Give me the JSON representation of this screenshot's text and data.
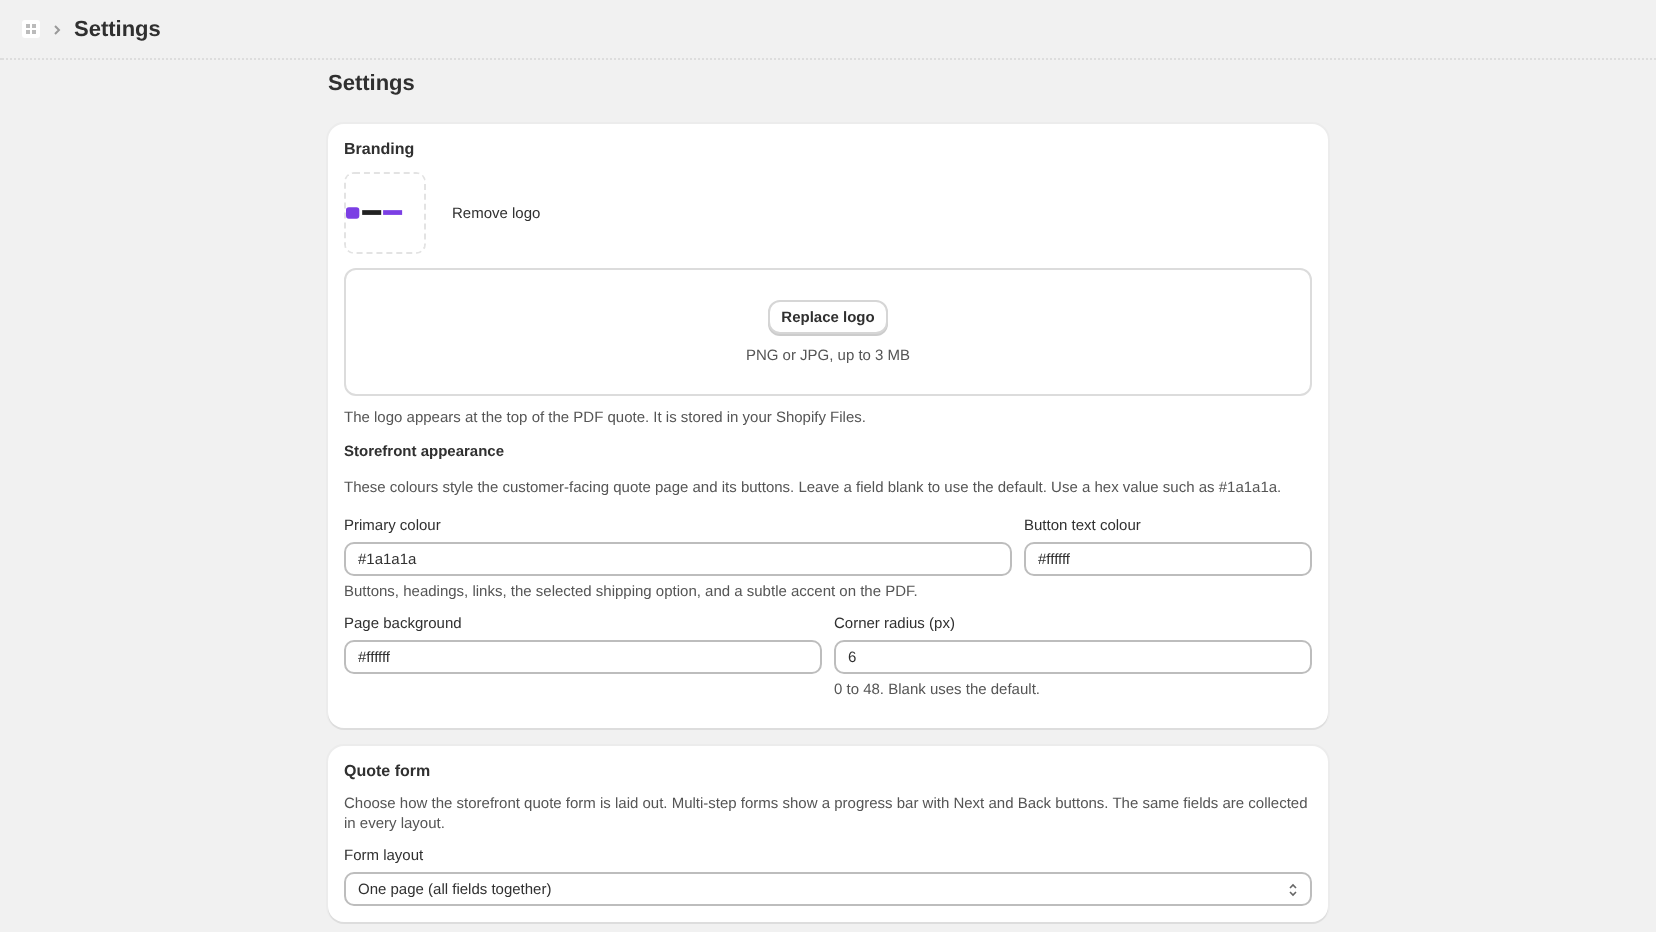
{
  "breadcrumb": {
    "current": "Settings"
  },
  "page_title": "Settings",
  "branding": {
    "title": "Branding",
    "remove_label": "Remove logo",
    "replace_label": "Replace logo",
    "upload_hint": "PNG or JPG, up to 3 MB",
    "help": "The logo appears at the top of the PDF quote. It is stored in your Shopify Files."
  },
  "storefront": {
    "title": "Storefront appearance",
    "description": "These colours style the customer-facing quote page and its buttons. Leave a field blank to use the default. Use a hex value such as #1a1a1a.",
    "rows": [
      {
        "fields": [
          {
            "label": "Primary colour",
            "value": "#1a1a1a",
            "help": "Buttons, headings, links, the selected shipping option, and a subtle accent on the PDF."
          },
          {
            "label": "Button text colour",
            "value": "#ffffff"
          }
        ]
      },
      {
        "fields": [
          {
            "label": "Page background",
            "value": "#ffffff"
          },
          {
            "label": "Corner radius (px)",
            "value": "6",
            "help": "0 to 48. Blank uses the default."
          }
        ]
      }
    ]
  },
  "quote_form": {
    "title": "Quote form",
    "description": "Choose how the storefront quote form is laid out. Multi-step forms show a progress bar with Next and Back buttons. The same fields are collected in every layout.",
    "field": {
      "label": "Form layout",
      "value": "One page (all fields together)"
    }
  }
}
